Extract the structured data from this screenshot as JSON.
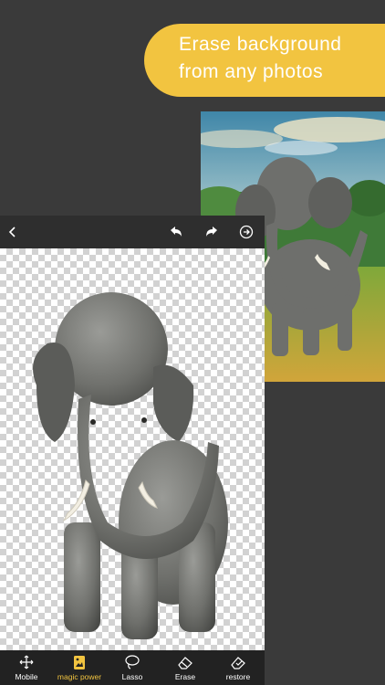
{
  "banner": {
    "line1": "Erase background",
    "line2": "from any photos"
  },
  "colors": {
    "accent": "#f2c440",
    "background": "#3a3a3a",
    "toolbar": "#222222"
  },
  "topbar": {
    "icons": [
      "back-chevron-icon",
      "undo-icon",
      "redo-icon",
      "export-icon"
    ]
  },
  "toolbar": {
    "tools": [
      {
        "label": "Mobile",
        "icon": "move-arrows-icon",
        "active": false
      },
      {
        "label": "magic power",
        "icon": "magic-image-icon",
        "active": true
      },
      {
        "label": "Lasso",
        "icon": "lasso-icon",
        "active": false
      },
      {
        "label": "Erase",
        "icon": "eraser-icon",
        "active": false
      },
      {
        "label": "restore",
        "icon": "restore-brush-icon",
        "active": false
      }
    ]
  }
}
